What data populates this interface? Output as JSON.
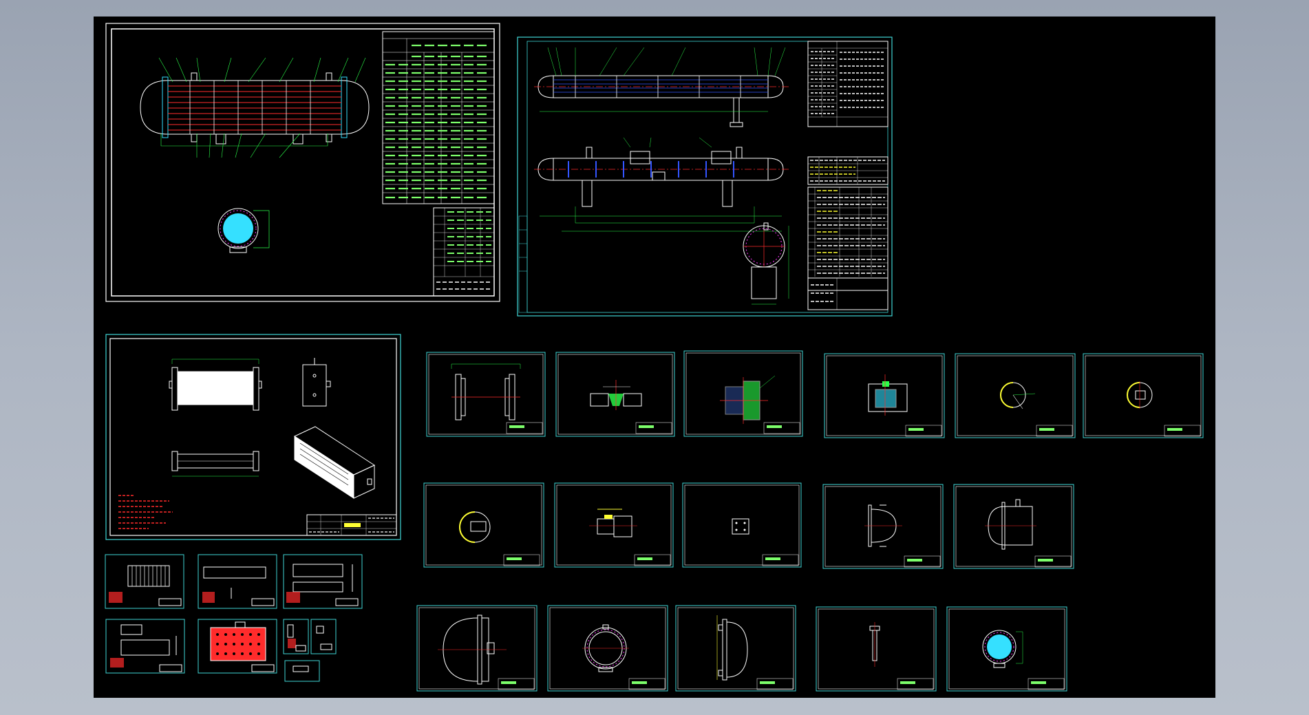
{
  "viewport": {
    "name": "cad-model-space",
    "background": "#000000"
  },
  "colors": {
    "frame": "#3fd6d6",
    "white": "#ffffff",
    "cyan": "#35e0ff",
    "red": "#ff2b2b",
    "green": "#2bff4a",
    "yellow": "#ffff33",
    "magenta": "#ff33ff",
    "blue": "#3355ff",
    "tableGreen": "#7dff6b"
  },
  "sheets": [
    {
      "name": "sheet-heat-exchanger-assembly"
    },
    {
      "name": "sheet-general-arrangement"
    },
    {
      "name": "sheet-radiator-assembly"
    },
    {
      "name": "sheet-flange-detail"
    },
    {
      "name": "sheet-weld-detail-1"
    },
    {
      "name": "sheet-weld-detail-2"
    },
    {
      "name": "sheet-tube-joint"
    },
    {
      "name": "sheet-circle-detail-1"
    },
    {
      "name": "sheet-circle-detail-2"
    },
    {
      "name": "sheet-circle-detail-3"
    },
    {
      "name": "sheet-nozzle-detail"
    },
    {
      "name": "sheet-plate-detail"
    },
    {
      "name": "sheet-head-detail"
    },
    {
      "name": "sheet-channel-detail"
    },
    {
      "name": "sheet-shell-part-1"
    },
    {
      "name": "sheet-shell-flange"
    },
    {
      "name": "sheet-head-part"
    },
    {
      "name": "sheet-support-leg"
    },
    {
      "name": "sheet-section-view"
    }
  ]
}
